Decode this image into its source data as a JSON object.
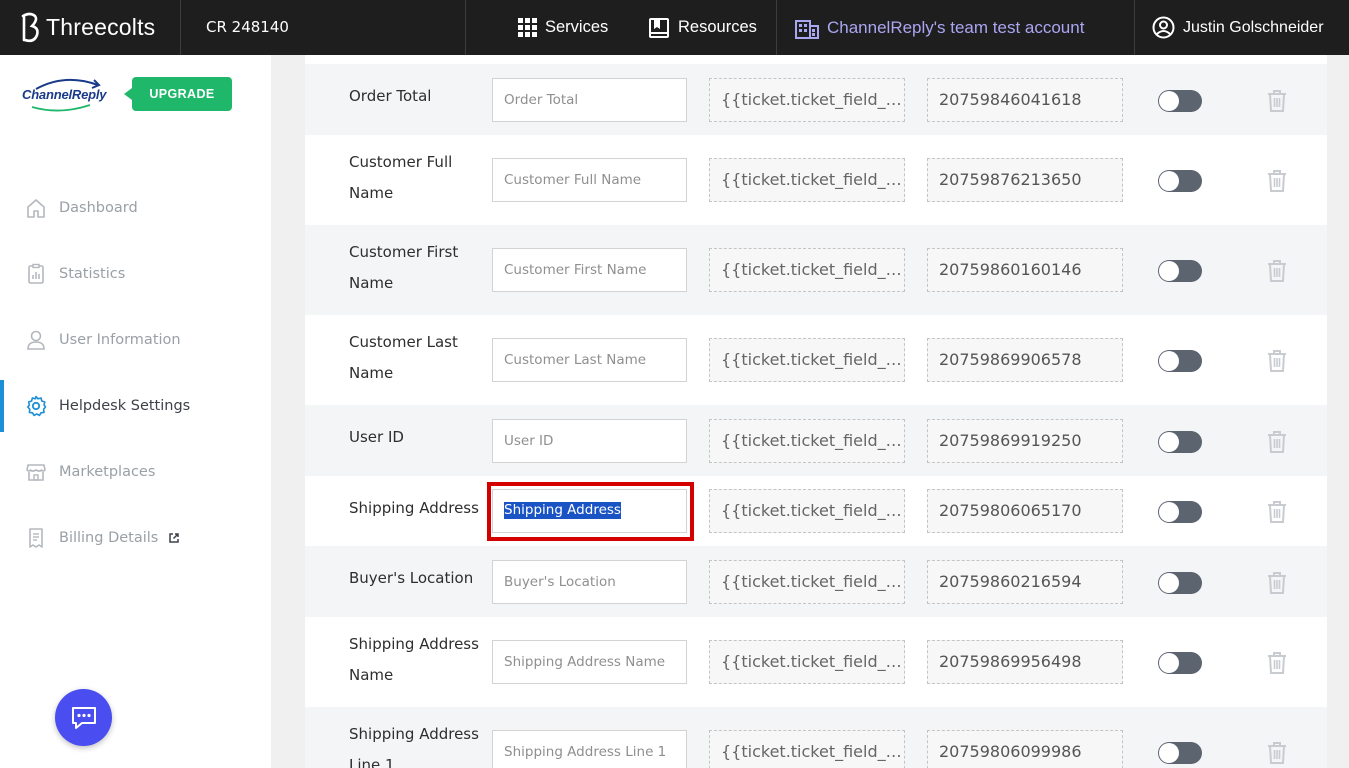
{
  "topbar": {
    "brand": "Threecolts",
    "account_id": "CR 248140",
    "services": "Services",
    "resources": "Resources",
    "team": "ChannelReply's team test account",
    "user": "Justin Golschneider"
  },
  "sidebar": {
    "logo_text": "ChannelReply",
    "upgrade": "UPGRADE",
    "items": [
      {
        "label": "Dashboard",
        "icon": "home-icon"
      },
      {
        "label": "Statistics",
        "icon": "clipboard-chart-icon"
      },
      {
        "label": "User Information",
        "icon": "user-icon"
      },
      {
        "label": "Helpdesk Settings",
        "icon": "gear-icon",
        "active": true
      },
      {
        "label": "Marketplaces",
        "icon": "store-icon"
      },
      {
        "label": "Billing Details",
        "icon": "receipt-icon",
        "external": true
      }
    ]
  },
  "fields": [
    {
      "label": "Order Total",
      "placeholder": "Order Total",
      "value": "",
      "template": "{{ticket.ticket_field_2...",
      "field_id": "20759846041618",
      "enabled": false
    },
    {
      "label": "Customer Full Name",
      "placeholder": "Customer Full Name",
      "value": "",
      "template": "{{ticket.ticket_field_2...",
      "field_id": "20759876213650",
      "enabled": false
    },
    {
      "label": "Customer First Name",
      "placeholder": "Customer First Name",
      "value": "",
      "template": "{{ticket.ticket_field_2...",
      "field_id": "20759860160146",
      "enabled": false
    },
    {
      "label": "Customer Last Name",
      "placeholder": "Customer Last Name",
      "value": "",
      "template": "{{ticket.ticket_field_2...",
      "field_id": "20759869906578",
      "enabled": false
    },
    {
      "label": "User ID",
      "placeholder": "User ID",
      "value": "",
      "template": "{{ticket.ticket_field_2...",
      "field_id": "20759869919250",
      "enabled": false
    },
    {
      "label": "Shipping Address",
      "placeholder": "Shipping Address",
      "value": "Shipping Address",
      "template": "{{ticket.ticket_field_2...",
      "field_id": "20759806065170",
      "enabled": false,
      "selected": true
    },
    {
      "label": "Buyer's Location",
      "placeholder": "Buyer's Location",
      "value": "",
      "template": "{{ticket.ticket_field_2...",
      "field_id": "20759860216594",
      "enabled": false
    },
    {
      "label": "Shipping Address Name",
      "placeholder": "Shipping Address Name",
      "value": "",
      "template": "{{ticket.ticket_field_2...",
      "field_id": "20759869956498",
      "enabled": false
    },
    {
      "label": "Shipping Address Line 1",
      "placeholder": "Shipping Address Line 1",
      "value": "",
      "template": "{{ticket.ticket_field_2...",
      "field_id": "20759806099986",
      "enabled": false
    }
  ],
  "colors": {
    "topbar": "#1e1e1e",
    "team_accent": "#a9a6f2",
    "upgrade": "#1fb86b",
    "active_nav": "#1c8fd6",
    "chat": "#4a4df0",
    "highlight": "#d40000",
    "toggle_off": "#5c6470"
  }
}
